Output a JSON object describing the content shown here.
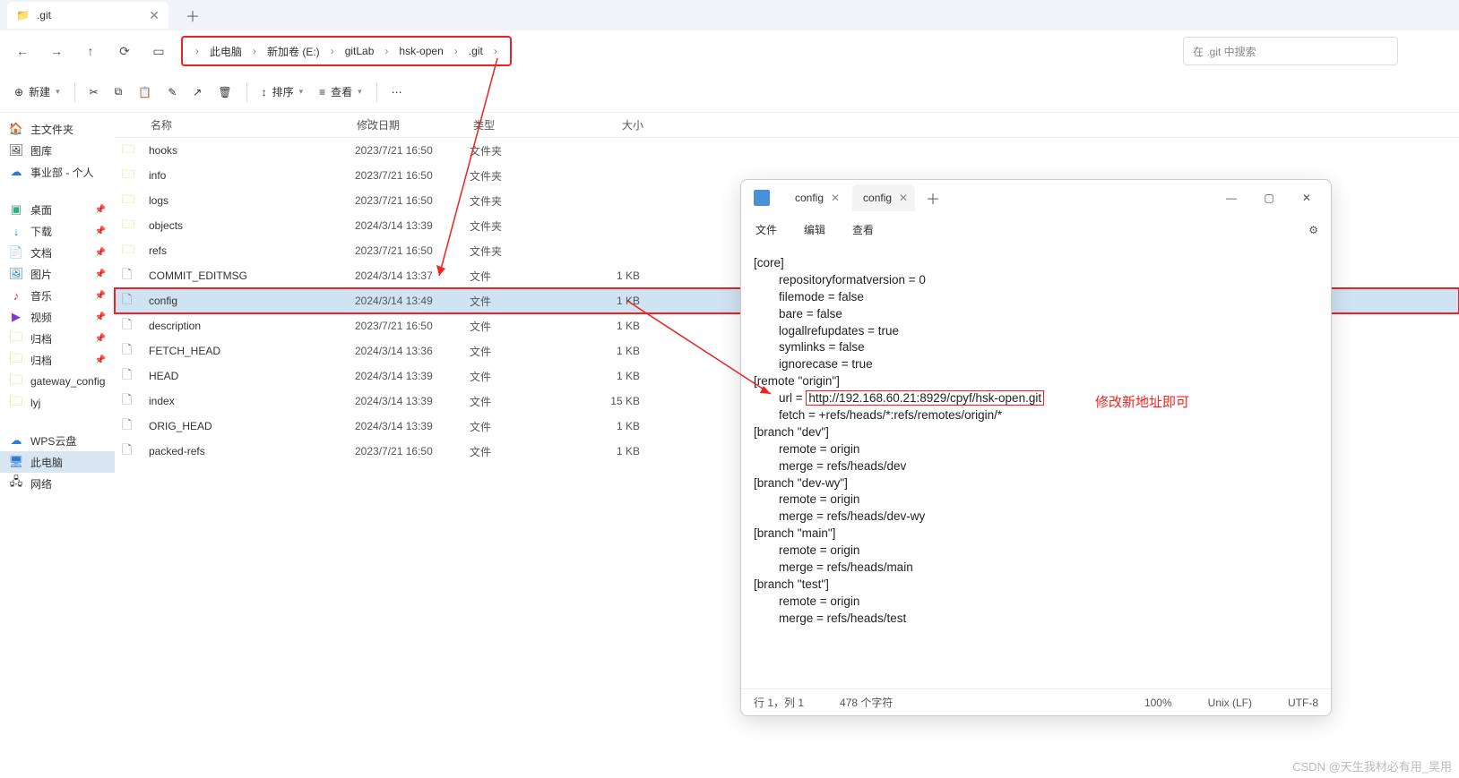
{
  "window": {
    "tab_title": ".git",
    "search_placeholder": "在 .git 中搜索"
  },
  "nav": {
    "back": "←",
    "forward": "→",
    "up": "↑",
    "refresh": "⟳"
  },
  "breadcrumbs": [
    "此电脑",
    "新加卷 (E:)",
    "gitLab",
    "hsk-open",
    ".git"
  ],
  "toolbar": {
    "new": "新建",
    "sort": "排序",
    "view": "查看"
  },
  "sidebar": {
    "home": "主文件夹",
    "gallery": "图库",
    "dept": "事业部 - 个人",
    "desktop": "桌面",
    "downloads": "下载",
    "documents": "文档",
    "pictures": "图片",
    "music": "音乐",
    "videos": "视频",
    "archive1": "归档",
    "archive2": "归档",
    "gateway": "gateway_config",
    "lyj": "lyj",
    "wps": "WPS云盘",
    "thispc": "此电脑",
    "network": "网络"
  },
  "columns": {
    "name": "名称",
    "date": "修改日期",
    "type": "类型",
    "size": "大小"
  },
  "rows": [
    {
      "icon": "folder",
      "name": "hooks",
      "date": "2023/7/21 16:50",
      "type": "文件夹",
      "size": ""
    },
    {
      "icon": "folder",
      "name": "info",
      "date": "2023/7/21 16:50",
      "type": "文件夹",
      "size": ""
    },
    {
      "icon": "folder",
      "name": "logs",
      "date": "2023/7/21 16:50",
      "type": "文件夹",
      "size": ""
    },
    {
      "icon": "folder",
      "name": "objects",
      "date": "2024/3/14 13:39",
      "type": "文件夹",
      "size": ""
    },
    {
      "icon": "folder",
      "name": "refs",
      "date": "2023/7/21 16:50",
      "type": "文件夹",
      "size": ""
    },
    {
      "icon": "file",
      "name": "COMMIT_EDITMSG",
      "date": "2024/3/14 13:37",
      "type": "文件",
      "size": "1 KB"
    },
    {
      "icon": "file",
      "name": "config",
      "date": "2024/3/14 13:49",
      "type": "文件",
      "size": "1 KB",
      "selected": true
    },
    {
      "icon": "file",
      "name": "description",
      "date": "2023/7/21 16:50",
      "type": "文件",
      "size": "1 KB"
    },
    {
      "icon": "file",
      "name": "FETCH_HEAD",
      "date": "2024/3/14 13:36",
      "type": "文件",
      "size": "1 KB"
    },
    {
      "icon": "file",
      "name": "HEAD",
      "date": "2024/3/14 13:39",
      "type": "文件",
      "size": "1 KB"
    },
    {
      "icon": "file",
      "name": "index",
      "date": "2024/3/14 13:39",
      "type": "文件",
      "size": "15 KB"
    },
    {
      "icon": "file",
      "name": "ORIG_HEAD",
      "date": "2024/3/14 13:39",
      "type": "文件",
      "size": "1 KB"
    },
    {
      "icon": "file",
      "name": "packed-refs",
      "date": "2023/7/21 16:50",
      "type": "文件",
      "size": "1 KB"
    }
  ],
  "editor": {
    "tab_inactive": "config",
    "tab_active": "config",
    "menu_file": "文件",
    "menu_edit": "编辑",
    "menu_view": "查看",
    "url": "http://192.168.60.21:8929/cpyf/hsk-open.git",
    "lines": {
      "l1": "[core]",
      "l2": "repositoryformatversion = 0",
      "l3": "filemode = false",
      "l4": "bare = false",
      "l5": "logallrefupdates = true",
      "l6": "symlinks = false",
      "l7": "ignorecase = true",
      "l8": "[remote \"origin\"]",
      "l9a": "url = ",
      "l10": "fetch = +refs/heads/*:refs/remotes/origin/*",
      "l11": "[branch \"dev\"]",
      "l12": "remote = origin",
      "l13": "merge = refs/heads/dev",
      "l14": "[branch \"dev-wy\"]",
      "l15": "remote = origin",
      "l16": "merge = refs/heads/dev-wy",
      "l17": "[branch \"main\"]",
      "l18": "remote = origin",
      "l19": "merge = refs/heads/main",
      "l20": "[branch \"test\"]",
      "l21": "remote = origin",
      "l22": "merge = refs/heads/test"
    },
    "status": {
      "pos": "行 1，列 1",
      "chars": "478 个字符",
      "zoom": "100%",
      "eol": "Unix (LF)",
      "enc": "UTF-8"
    }
  },
  "annotation": "修改新地址即可",
  "watermark": "CSDN @天生我材必有用_吴用"
}
